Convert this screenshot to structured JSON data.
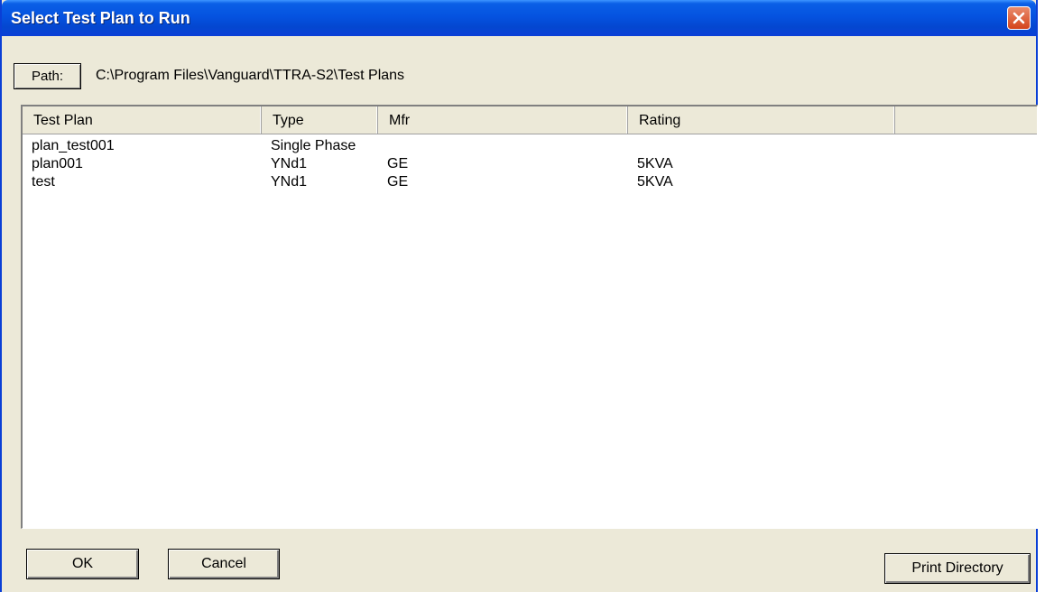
{
  "window": {
    "title": "Select Test Plan to Run"
  },
  "path": {
    "button_label": "Path:",
    "value": "C:\\Program Files\\Vanguard\\TTRA-S2\\Test Plans"
  },
  "table": {
    "columns": [
      "Test Plan",
      "Type",
      "Mfr",
      "Rating",
      ""
    ],
    "rows": [
      {
        "test_plan": "plan_test001",
        "type": "Single Phase",
        "mfr": "",
        "rating": ""
      },
      {
        "test_plan": "plan001",
        "type": "YNd1",
        "mfr": "GE",
        "rating": "5KVA"
      },
      {
        "test_plan": "test",
        "type": "YNd1",
        "mfr": "GE",
        "rating": "5KVA"
      }
    ]
  },
  "buttons": {
    "ok": "OK",
    "cancel": "Cancel",
    "print_directory": "Print Directory"
  },
  "icons": {
    "close": "close-icon"
  }
}
